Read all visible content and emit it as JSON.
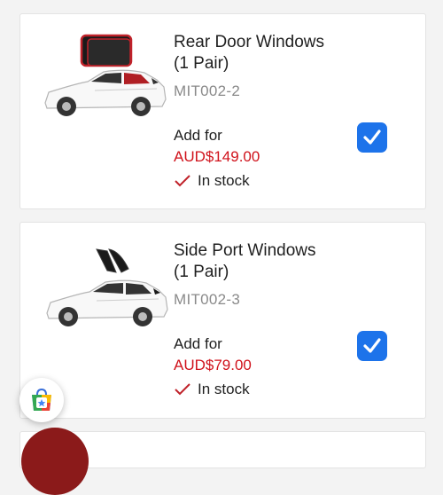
{
  "products": [
    {
      "title_line1": "Rear Door Windows",
      "title_line2": "(1 Pair)",
      "sku": "MIT002-2",
      "add_for_label": "Add for",
      "price": "AUD$149.00",
      "stock": "In stock",
      "checked": true,
      "thumb_icon": "car-with-rear-door-shades-image"
    },
    {
      "title_line1": "Side Port Windows",
      "title_line2": "(1 Pair)",
      "sku": "MIT002-3",
      "add_for_label": "Add for",
      "price": "AUD$79.00",
      "stock": "In stock",
      "checked": true,
      "thumb_icon": "car-with-side-port-shades-image"
    }
  ],
  "colors": {
    "price": "#d0121b",
    "checkbox": "#1d73ea",
    "background": "#f3f3f3"
  },
  "floating_button_icon": "shopping-bag-star-icon"
}
